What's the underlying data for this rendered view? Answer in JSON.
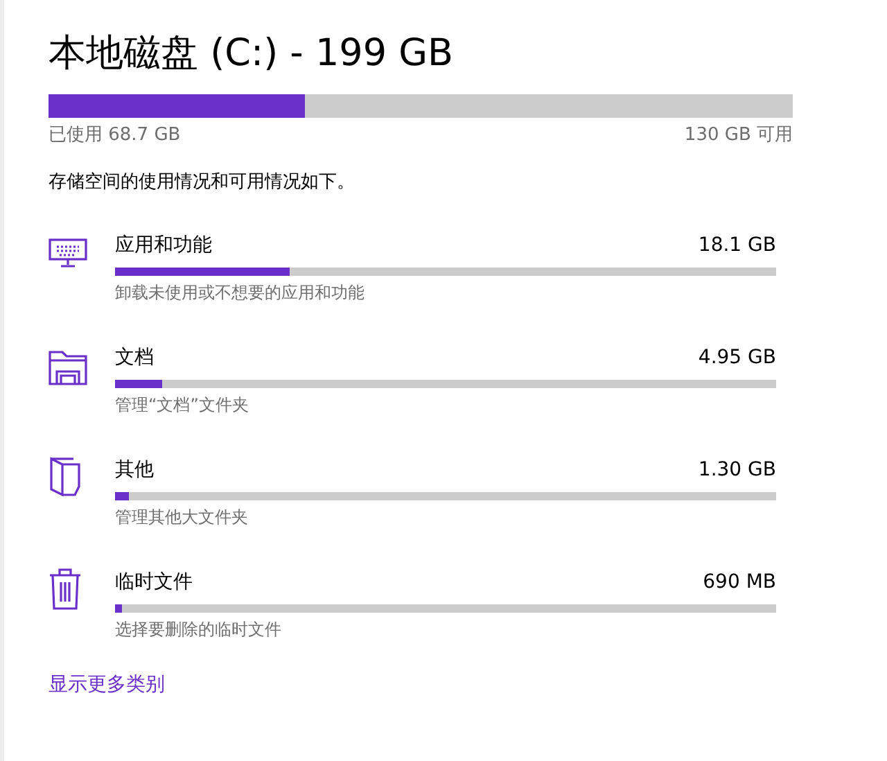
{
  "title": "本地磁盘 (C:) - 199 GB",
  "usage": {
    "level": 0.345,
    "used": "已使用 68.7 GB",
    "free": "130 GB 可用"
  },
  "description": "存储空间的使用情况和可用情况如下。",
  "categories": [
    {
      "kind": "apps",
      "name": "应用和功能",
      "size": "18.1 GB",
      "level": 0.265,
      "link": "卸载未使用或不想要的应用和功能"
    },
    {
      "kind": "documents",
      "name": "文档",
      "size": "4.95 GB",
      "level": 0.071,
      "link": "管理“文档”文件夹"
    },
    {
      "kind": "other",
      "name": "其他",
      "size": "1.30 GB",
      "level": 0.021,
      "link": "管理其他大文件夹"
    },
    {
      "kind": "temp",
      "name": "临时文件",
      "size": "690 MB",
      "level": 0.01,
      "link": "选择要删除的临时文件"
    }
  ],
  "more_link": "显示更多类别"
}
